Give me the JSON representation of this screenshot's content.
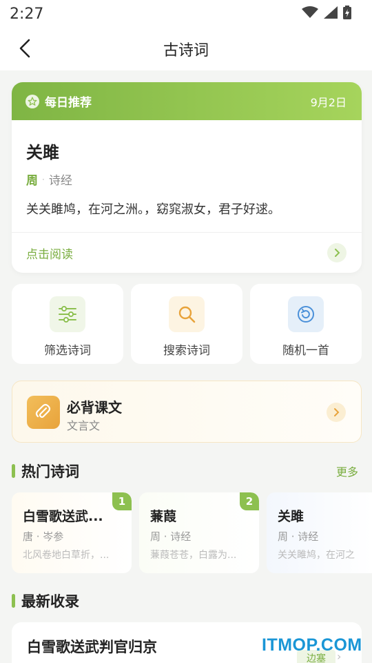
{
  "status_bar": {
    "time": "2:27"
  },
  "nav": {
    "title": "古诗词"
  },
  "daily": {
    "tag": "每日推荐",
    "date": "9月2日",
    "title": "关雎",
    "dynasty": "周",
    "separator": "·",
    "collection": "诗经",
    "line": "关关雎鸠，在河之洲。，窈窕淑女，君子好逑。",
    "read_label": "点击阅读"
  },
  "actions": [
    {
      "label": "筛选诗词",
      "icon": "filter-sliders-icon",
      "color": "#8dc050"
    },
    {
      "label": "搜索诗词",
      "icon": "search-icon",
      "color": "#e8a33b"
    },
    {
      "label": "随机一首",
      "icon": "refresh-icon",
      "color": "#4a90d9"
    }
  ],
  "recite": {
    "title": "必背课文",
    "subtitle": "文言文",
    "icon": "paperclip-icon"
  },
  "hot": {
    "title": "热门诗词",
    "more": "更多",
    "items": [
      {
        "rank": "1",
        "title": "白雪歌送武...",
        "meta": "唐 · 岑参",
        "line": "北风卷地白草折，..."
      },
      {
        "rank": "2",
        "title": "蒹葭",
        "meta": "周 · 诗经",
        "line": "蒹葭苍苍，白露为..."
      },
      {
        "rank": "",
        "title": "关雎",
        "meta": "周 · 诗经",
        "line": "关关雎鸠，在河之"
      }
    ]
  },
  "newest": {
    "title": "最新收录",
    "item_title": "白雪歌送武判官归京",
    "item_tag": "边塞",
    "arrow": "›"
  },
  "watermark": {
    "text": "ITMOP.COM"
  },
  "colors": {
    "accent": "#8dc050",
    "accent_text": "#79ad3f",
    "recite": "#e8a33b",
    "random": "#4a90d9"
  }
}
